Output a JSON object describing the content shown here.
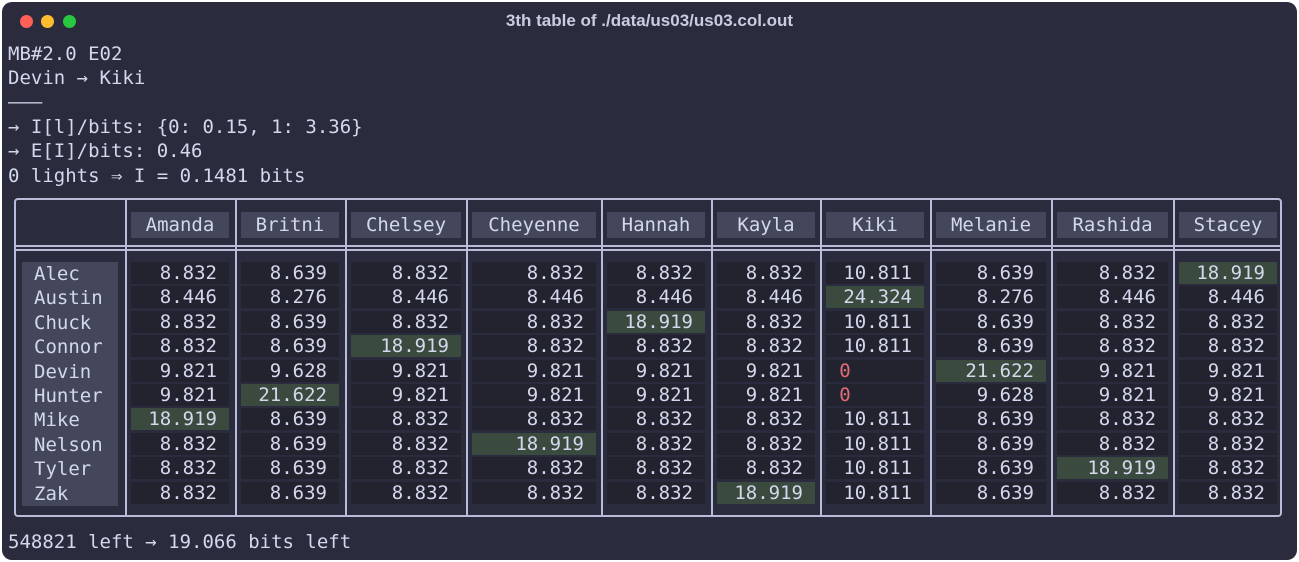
{
  "window": {
    "title": "3th table of ./data/us03/us03.col.out"
  },
  "header_lines": [
    "MB#2.0 E02",
    "Devin → Kiki",
    "———",
    "→ I[l]/bits: {0: 0.15, 1: 3.36}",
    "→ E[I]/bits: 0.46",
    "0 lights ⇒ I = 0.1481 bits"
  ],
  "table": {
    "columns": [
      "Amanda",
      "Britni",
      "Chelsey",
      "Cheyenne",
      "Hannah",
      "Kayla",
      "Kiki",
      "Melanie",
      "Rashida",
      "Stacey"
    ],
    "rows": [
      "Alec",
      "Austin",
      "Chuck",
      "Connor",
      "Devin",
      "Hunter",
      "Mike",
      "Nelson",
      "Tyler",
      "Zak"
    ],
    "values": [
      [
        "8.832",
        "8.639",
        "8.832",
        "8.832",
        "8.832",
        "8.832",
        "10.811",
        "8.639",
        "8.832",
        "18.919"
      ],
      [
        "8.446",
        "8.276",
        "8.446",
        "8.446",
        "8.446",
        "8.446",
        "24.324",
        "8.276",
        "8.446",
        "8.446"
      ],
      [
        "8.832",
        "8.639",
        "8.832",
        "8.832",
        "18.919",
        "8.832",
        "10.811",
        "8.639",
        "8.832",
        "8.832"
      ],
      [
        "8.832",
        "8.639",
        "18.919",
        "8.832",
        "8.832",
        "8.832",
        "10.811",
        "8.639",
        "8.832",
        "8.832"
      ],
      [
        "9.821",
        "9.628",
        "9.821",
        "9.821",
        "9.821",
        "9.821",
        "0",
        "21.622",
        "9.821",
        "9.821"
      ],
      [
        "9.821",
        "21.622",
        "9.821",
        "9.821",
        "9.821",
        "9.821",
        "0",
        "9.628",
        "9.821",
        "9.821"
      ],
      [
        "18.919",
        "8.639",
        "8.832",
        "8.832",
        "8.832",
        "8.832",
        "10.811",
        "8.639",
        "8.832",
        "8.832"
      ],
      [
        "8.832",
        "8.639",
        "8.832",
        "18.919",
        "8.832",
        "8.832",
        "10.811",
        "8.639",
        "8.832",
        "8.832"
      ],
      [
        "8.832",
        "8.639",
        "8.832",
        "8.832",
        "8.832",
        "8.832",
        "10.811",
        "8.639",
        "18.919",
        "8.832"
      ],
      [
        "8.832",
        "8.639",
        "8.832",
        "8.832",
        "8.832",
        "18.919",
        "10.811",
        "8.639",
        "8.832",
        "8.832"
      ]
    ],
    "highlighted": [
      [
        0,
        9
      ],
      [
        1,
        6
      ],
      [
        2,
        4
      ],
      [
        3,
        2
      ],
      [
        4,
        7
      ],
      [
        5,
        1
      ],
      [
        6,
        0
      ],
      [
        7,
        3
      ],
      [
        8,
        8
      ],
      [
        9,
        5
      ]
    ],
    "colors": {
      "highlight": "#3a4a3e",
      "zero": "#e06c75"
    }
  },
  "footer": {
    "text": "548821 left → 19.066 bits left"
  }
}
